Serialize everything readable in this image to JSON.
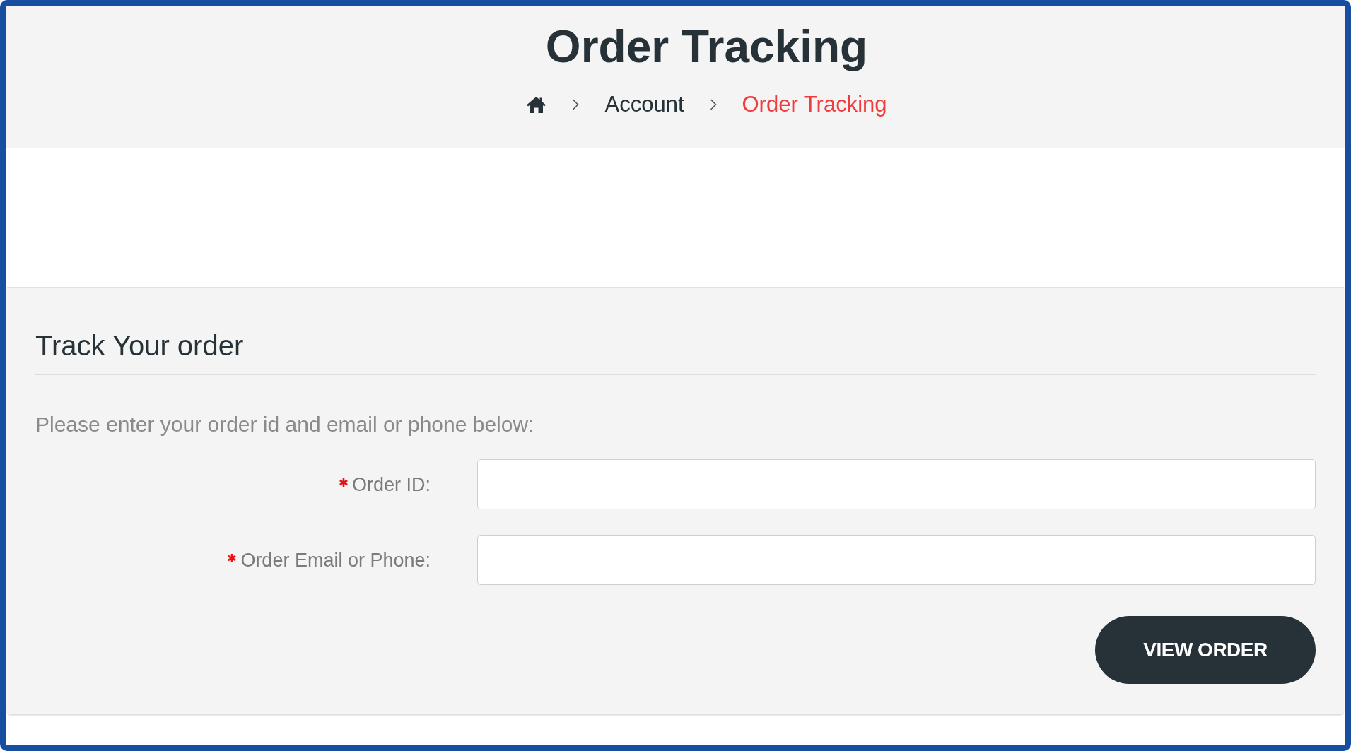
{
  "header": {
    "title": "Order Tracking",
    "breadcrumb": [
      {
        "label": "Account",
        "current": false
      },
      {
        "label": "Order Tracking",
        "current": true
      }
    ]
  },
  "form": {
    "title": "Track Your order",
    "instructions": "Please enter your order id and email or phone below:",
    "fields": [
      {
        "label": "Order ID:",
        "required": true
      },
      {
        "label": "Order Email or Phone:",
        "required": true
      }
    ],
    "submit": "VIEW ORDER"
  }
}
